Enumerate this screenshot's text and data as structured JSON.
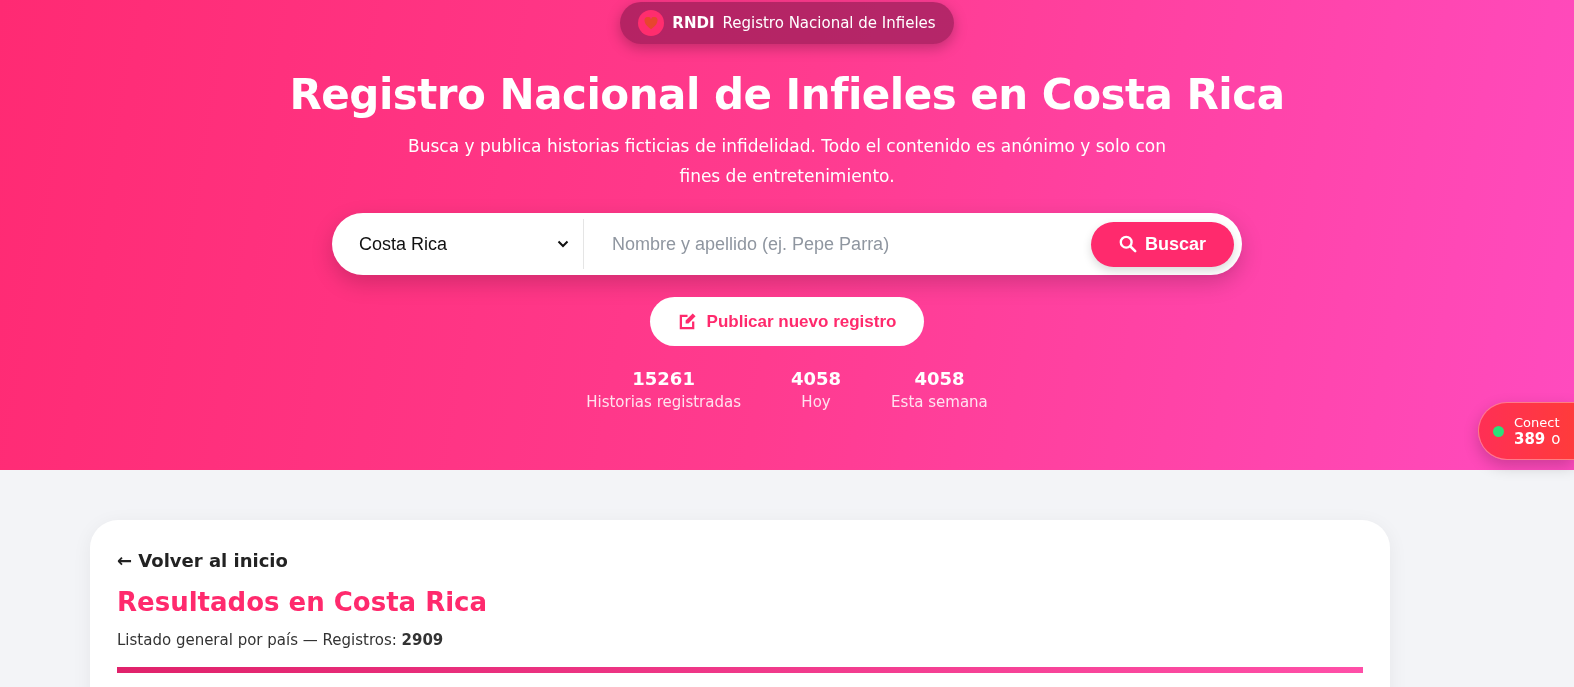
{
  "brand": {
    "short": "RNDI",
    "name": "Registro Nacional de Infieles"
  },
  "hero": {
    "title": "Registro Nacional de Infieles en Costa Rica",
    "subtitle": "Busca y publica historias ficticias de infidelidad. Todo el contenido es anónimo y solo con fines de entretenimiento."
  },
  "search": {
    "country": "Costa Rica",
    "placeholder": "Nombre y apellido (ej. Pepe Parra)",
    "button": "Buscar"
  },
  "publish_button": "Publicar nuevo registro",
  "stats": [
    {
      "value": "15261",
      "label": "Historias registradas"
    },
    {
      "value": "4058",
      "label": "Hoy"
    },
    {
      "value": "4058",
      "label": "Esta semana"
    }
  ],
  "online": {
    "label": "Conect",
    "count": "389",
    "suffix": "o"
  },
  "results": {
    "back_link": "← Volver al inicio",
    "title": "Resultados en Costa Rica",
    "summary": "Listado general por país — Registros: **2909**"
  }
}
